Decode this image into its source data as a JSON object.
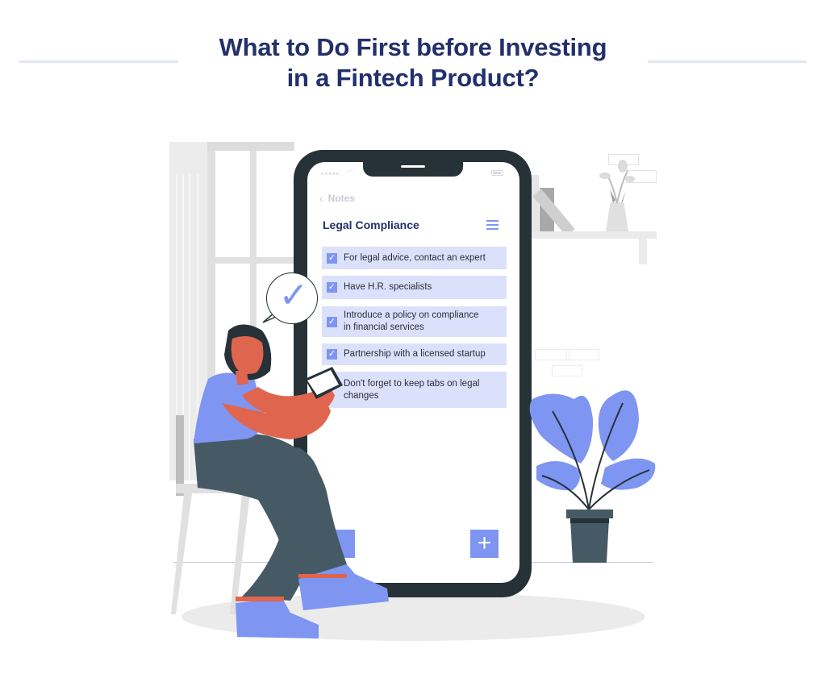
{
  "header": {
    "title_line1": "What to Do First before Investing",
    "title_line2": "in a Fintech Product?"
  },
  "phone": {
    "status_dots": "●●●●●",
    "back_label": "Notes",
    "note_title": "Legal Compliance",
    "checklist": [
      {
        "text_line1": "For legal advice, contact an expert",
        "text_line2": "",
        "checked": true
      },
      {
        "text_line1": "Have H.R. specialists",
        "text_line2": "",
        "checked": true
      },
      {
        "text_line1": "Introduce a policy on compliance",
        "text_line2": "in financial services",
        "checked": true
      },
      {
        "text_line1": "Partnership with a licensed startup",
        "text_line2": "",
        "checked": true
      },
      {
        "text_line1": "Don't forget to keep tabs on legal",
        "text_line2": "changes",
        "checked": false
      }
    ],
    "check_glyph": "✓",
    "add_glyph": "+"
  },
  "illustration": {
    "bubble_glyph": "✓",
    "colors": {
      "accent": "#7e95f2",
      "dark": "#263238",
      "skin": "#e0654f",
      "pants": "#455a64",
      "title": "#22306b",
      "item_bg": "#dbe1fb"
    }
  }
}
